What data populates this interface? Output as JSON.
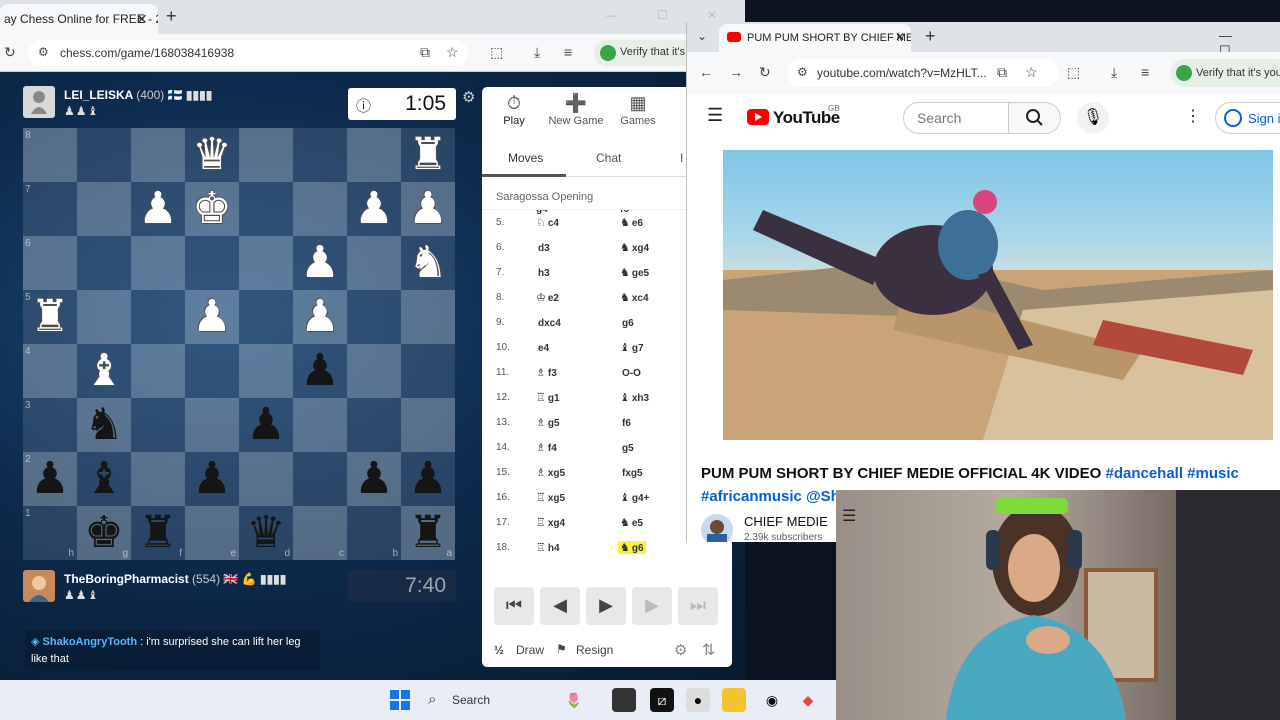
{
  "chess_browser": {
    "tab_title": "ay Chess Online for FREE - 2 P",
    "url": "chess.com/game/168038416938",
    "verify_text": "Verify that it's you"
  },
  "top_player": {
    "name": "LEI_LEISKA",
    "rating": "(400)",
    "flag": "🇫🇮",
    "captured": "♟♟♝",
    "clock": "1:05"
  },
  "bottom_player": {
    "name": "TheBoringPharmacist",
    "rating": "(554)",
    "flag": "🇬🇧 💪",
    "captured": "♟♟♝",
    "clock": "7:40"
  },
  "board": {
    "rank_labels": [
      "8",
      "7",
      "6",
      "5",
      "4",
      "3",
      "2",
      "1"
    ],
    "file_labels": [
      "h",
      "g",
      "f",
      "e",
      "d",
      "c",
      "b",
      "a"
    ],
    "light_color": "#b9c8d7",
    "dark_color": "#50698a",
    "rows": [
      [
        "",
        "",
        "",
        "wq",
        "",
        "",
        "",
        "wr"
      ],
      [
        "",
        "",
        "wp",
        "wk",
        "",
        "",
        "wp",
        "wp"
      ],
      [
        "",
        "",
        "",
        "",
        "",
        "wp",
        "",
        "wn"
      ],
      [
        "wr",
        "",
        "",
        "wp",
        "",
        "wp",
        "",
        ""
      ],
      [
        "",
        "wb",
        "",
        "",
        "",
        "bp",
        "",
        ""
      ],
      [
        "",
        "bn",
        "",
        "",
        "bp",
        "",
        "",
        ""
      ],
      [
        "bp",
        "bb",
        "",
        "bp",
        "",
        "",
        "bp",
        "bp"
      ],
      [
        "",
        "bk",
        "br",
        "",
        "bq",
        "",
        "",
        "br"
      ]
    ]
  },
  "chat": {
    "user": "ShakoAngryTooth",
    "message": ": i'm surprised she can lift her leg like that"
  },
  "panel": {
    "buttons": [
      {
        "label": "Play",
        "icon": "⏱"
      },
      {
        "label": "New Game",
        "icon": "➕"
      },
      {
        "label": "Games",
        "icon": "▦"
      }
    ],
    "tabs": [
      "Moves",
      "Chat",
      "I"
    ],
    "opening": "Saragossa Opening",
    "partial_row": {
      "w": "g4",
      "b": "f6"
    },
    "moves": [
      {
        "n": "5.",
        "wg": "♘",
        "w": "c4",
        "bg": "♞",
        "b": "e6"
      },
      {
        "n": "6.",
        "wg": "",
        "w": "d3",
        "bg": "♞",
        "b": "xg4"
      },
      {
        "n": "7.",
        "wg": "",
        "w": "h3",
        "bg": "♞",
        "b": "ge5"
      },
      {
        "n": "8.",
        "wg": "♔",
        "w": "e2",
        "bg": "♞",
        "b": "xc4"
      },
      {
        "n": "9.",
        "wg": "",
        "w": "dxc4",
        "bg": "",
        "b": "g6"
      },
      {
        "n": "10.",
        "wg": "",
        "w": "e4",
        "bg": "♝",
        "b": "g7"
      },
      {
        "n": "11.",
        "wg": "♗",
        "w": "f3",
        "bg": "",
        "b": "O-O"
      },
      {
        "n": "12.",
        "wg": "♖",
        "w": "g1",
        "bg": "♝",
        "b": "xh3"
      },
      {
        "n": "13.",
        "wg": "♗",
        "w": "g5",
        "bg": "",
        "b": "f6"
      },
      {
        "n": "14.",
        "wg": "♗",
        "w": "f4",
        "bg": "",
        "b": "g5"
      },
      {
        "n": "15.",
        "wg": "♗",
        "w": "xg5",
        "bg": "",
        "b": "fxg5"
      },
      {
        "n": "16.",
        "wg": "♖",
        "w": "xg5",
        "bg": "♝",
        "b": "g4+"
      },
      {
        "n": "17.",
        "wg": "♖",
        "w": "xg4",
        "bg": "♞",
        "b": "e5"
      },
      {
        "n": "18.",
        "wg": "♖",
        "w": "h4",
        "bg": "♞",
        "b": "g6"
      }
    ],
    "nav": [
      "⏮",
      "◀",
      "▶",
      "▶",
      "⏭"
    ],
    "draw_label": "Draw",
    "draw_icon": "½",
    "resign_label": "Resign"
  },
  "youtube": {
    "tab_title": "PUM PUM SHORT BY CHIEF ME",
    "url": "youtube.com/watch?v=MzHLT...",
    "verify_text": "Verify that it's you",
    "logo_text": "YouTube",
    "logo_region": "GB",
    "search_placeholder": "Search",
    "sign_in": "Sign in",
    "video_title": "PUM PUM SHORT BY CHIEF MEDIE OFFICIAL 4K VIDEO",
    "hashtags": "#dancehall #music",
    "hashtags2": "#africanmusic @Sh",
    "channel": "CHIEF MEDIE",
    "subscribers": "2.39k subscribers"
  },
  "taskbar": {
    "search": "Search"
  }
}
